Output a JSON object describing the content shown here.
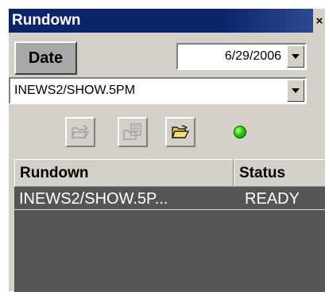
{
  "window": {
    "title": "Rundown",
    "close_label": "×"
  },
  "date": {
    "button_label": "Date",
    "value": "6/29/2006"
  },
  "rundown_select": {
    "value": "INEWS2/SHOW.5PM"
  },
  "toolbar": {
    "buttons": [
      {
        "icon": "open-folder-disabled-icon",
        "enabled": false
      },
      {
        "icon": "document-list-disabled-icon",
        "enabled": false
      },
      {
        "icon": "open-folder-icon",
        "enabled": true
      }
    ],
    "status_light": {
      "color": "#24d400",
      "meaning": "connected"
    }
  },
  "table": {
    "columns": [
      "Rundown",
      "Status"
    ],
    "rows": [
      {
        "rundown": "INEWS2/SHOW.5P...",
        "status": "READY"
      }
    ]
  },
  "colors": {
    "titlebar": "#0a246a",
    "panel": "#d4d0c8",
    "list_bg": "#555555",
    "date_button": "#a8a8a8"
  }
}
